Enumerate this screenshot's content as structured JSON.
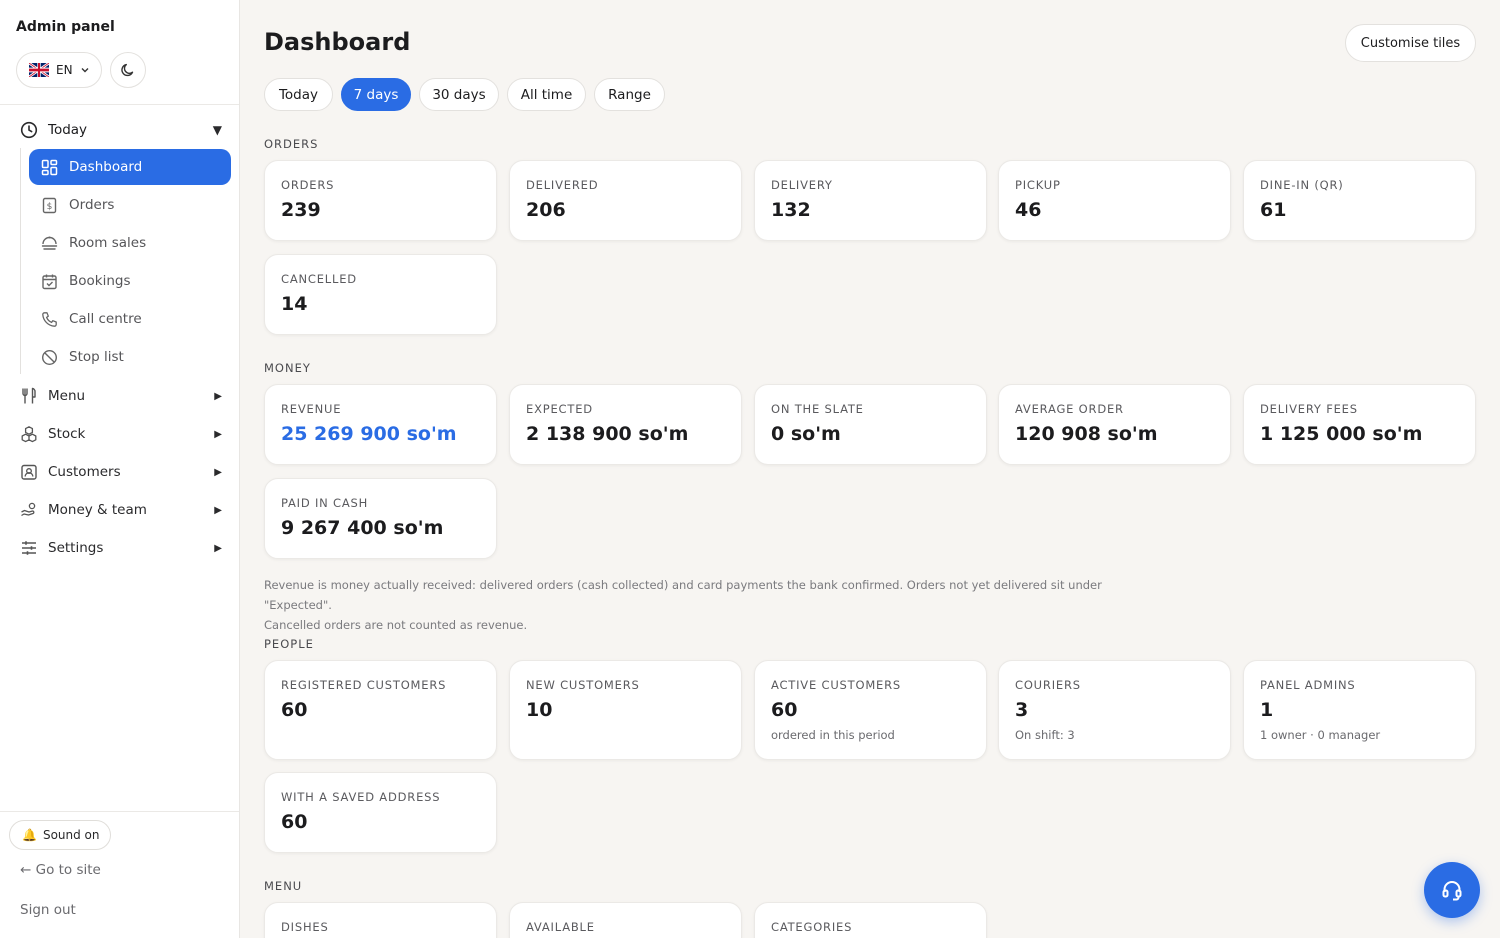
{
  "sidebar": {
    "brand": "Admin panel",
    "language": "EN",
    "groups": {
      "today": "Today",
      "menu": "Menu",
      "stock": "Stock",
      "customers": "Customers",
      "money_team": "Money & team",
      "settings": "Settings"
    },
    "items": [
      {
        "label": "Dashboard",
        "icon": "dashboard-icon"
      },
      {
        "label": "Orders",
        "icon": "receipt-icon"
      },
      {
        "label": "Room sales",
        "icon": "room-icon"
      },
      {
        "label": "Bookings",
        "icon": "calendar-icon"
      },
      {
        "label": "Call centre",
        "icon": "phone-icon"
      },
      {
        "label": "Stop list",
        "icon": "ban-icon"
      }
    ],
    "sound": "Sound on",
    "goto_site": "← Go to site",
    "sign_out": "Sign out"
  },
  "header": {
    "title": "Dashboard",
    "customise": "Customise tiles",
    "periods": [
      "Today",
      "7 days",
      "30 days",
      "All time",
      "Range"
    ],
    "active_period": "7 days"
  },
  "sections": {
    "orders": {
      "label": "ORDERS",
      "tiles": [
        {
          "label": "ORDERS",
          "value": "239"
        },
        {
          "label": "DELIVERED",
          "value": "206"
        },
        {
          "label": "DELIVERY",
          "value": "132"
        },
        {
          "label": "PICKUP",
          "value": "46"
        },
        {
          "label": "DINE-IN (QR)",
          "value": "61"
        },
        {
          "label": "CANCELLED",
          "value": "14"
        }
      ]
    },
    "money": {
      "label": "MONEY",
      "tiles": [
        {
          "label": "REVENUE",
          "value": "25 269 900 so'm"
        },
        {
          "label": "EXPECTED",
          "value": "2 138 900 so'm"
        },
        {
          "label": "ON THE SLATE",
          "value": "0 so'm"
        },
        {
          "label": "AVERAGE ORDER",
          "value": "120 908 so'm"
        },
        {
          "label": "DELIVERY FEES",
          "value": "1 125 000 so'm"
        },
        {
          "label": "PAID IN CASH",
          "value": "9 267 400 so'm"
        }
      ],
      "note_line1": "Revenue is money actually received: delivered orders (cash collected) and card payments the bank confirmed. Orders not yet delivered sit under \"Expected\".",
      "note_line2": "Cancelled orders are not counted as revenue."
    },
    "people": {
      "label": "PEOPLE",
      "tiles": [
        {
          "label": "REGISTERED CUSTOMERS",
          "value": "60"
        },
        {
          "label": "NEW CUSTOMERS",
          "value": "10"
        },
        {
          "label": "ACTIVE CUSTOMERS",
          "value": "60",
          "sub": "ordered in this period"
        },
        {
          "label": "COURIERS",
          "value": "3",
          "sub": "On shift: 3"
        },
        {
          "label": "PANEL ADMINS",
          "value": "1",
          "sub": "1 owner · 0 manager"
        },
        {
          "label": "WITH A SAVED ADDRESS",
          "value": "60"
        }
      ]
    },
    "menu": {
      "label": "MENU",
      "tiles": [
        {
          "label": "DISHES"
        },
        {
          "label": "AVAILABLE"
        },
        {
          "label": "CATEGORIES"
        }
      ]
    }
  },
  "colors": {
    "accent": "#2a6ce4",
    "background": "#f7f5f2"
  }
}
